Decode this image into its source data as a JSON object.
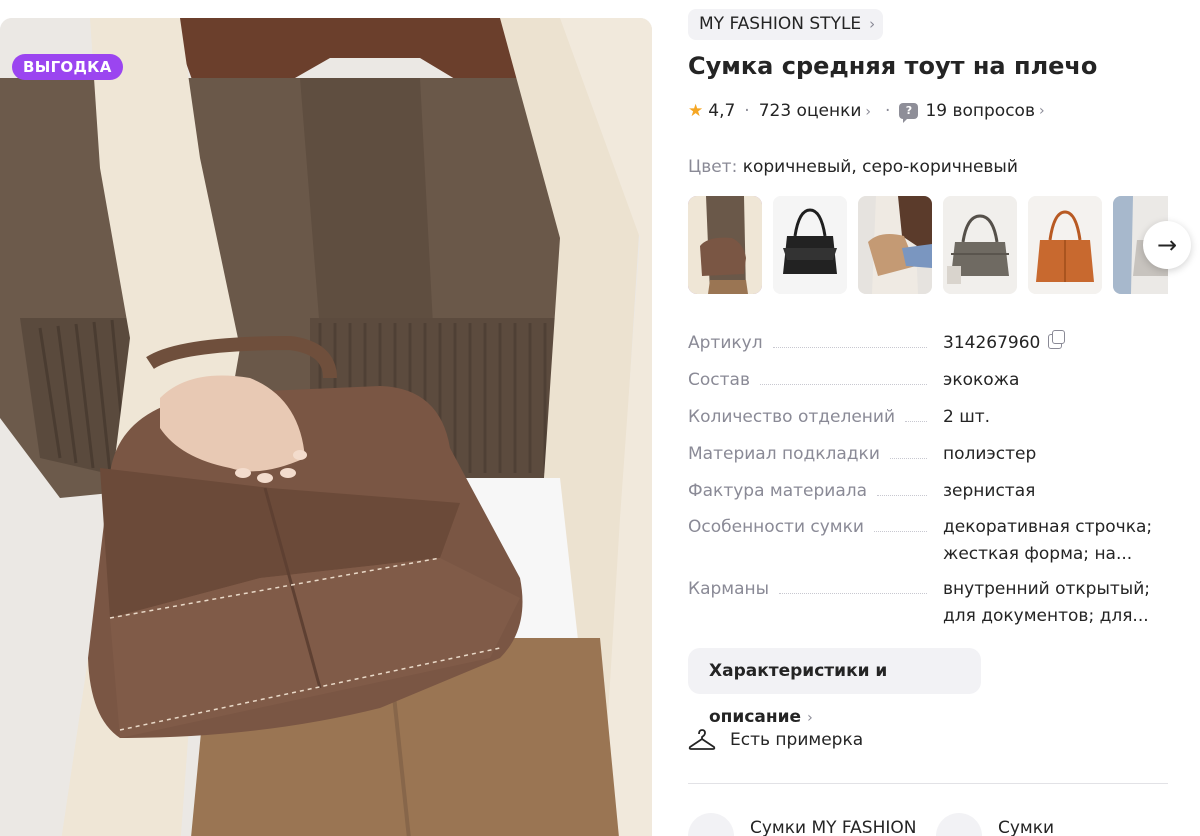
{
  "product": {
    "badge": "ВЫГОДКА",
    "brand": "MY FASHION STYLE",
    "title": "Сумка средняя тоут на плечо",
    "rating": "4,7",
    "reviews": "723 оценки",
    "questions": "19 вопросов",
    "color_label": "Цвет:",
    "color_value": "коричневый, серо-коричневый"
  },
  "icons": {
    "star": "star-icon",
    "question": "question-bubble-icon",
    "copy": "copy-icon",
    "hanger": "hanger-icon",
    "next": "arrow-right-icon",
    "chevron": "chevron-right-icon"
  },
  "colors": {
    "badge": "#9b45f0",
    "selected_border": "#a14ef0",
    "star": "#f5a623",
    "muted": "#8a8a96",
    "chip_bg": "#f2f2f5"
  },
  "thumbnails": [
    {
      "alt": "коричневая сумка на модели",
      "selected": true
    },
    {
      "alt": "черная сумка"
    },
    {
      "alt": "бежевая сумка на модели"
    },
    {
      "alt": "серо-коричневая сумка"
    },
    {
      "alt": "рыжая сумка тоут"
    },
    {
      "alt": "сумка на модели"
    }
  ],
  "specs": [
    {
      "key": "Артикул",
      "value": "314267960"
    },
    {
      "key": "Состав",
      "value": "экокожа"
    },
    {
      "key": "Количество отделений",
      "value": "2 шт."
    },
    {
      "key": "Материал подкладки",
      "value": "полиэстер"
    },
    {
      "key": "Фактура материала",
      "value": "зернистая"
    },
    {
      "key": "Особенности сумки",
      "value": "декоративная строчка; жесткая форма; на..."
    },
    {
      "key": "Карманы",
      "value": "внутренний открытый; для документов; для..."
    }
  ],
  "actions": {
    "details_button": "Характеристики и описание",
    "fitting": "Есть примерка"
  },
  "categories": [
    {
      "label": "Сумки MY FASHION STYLE"
    },
    {
      "label": "Сумки"
    }
  ]
}
